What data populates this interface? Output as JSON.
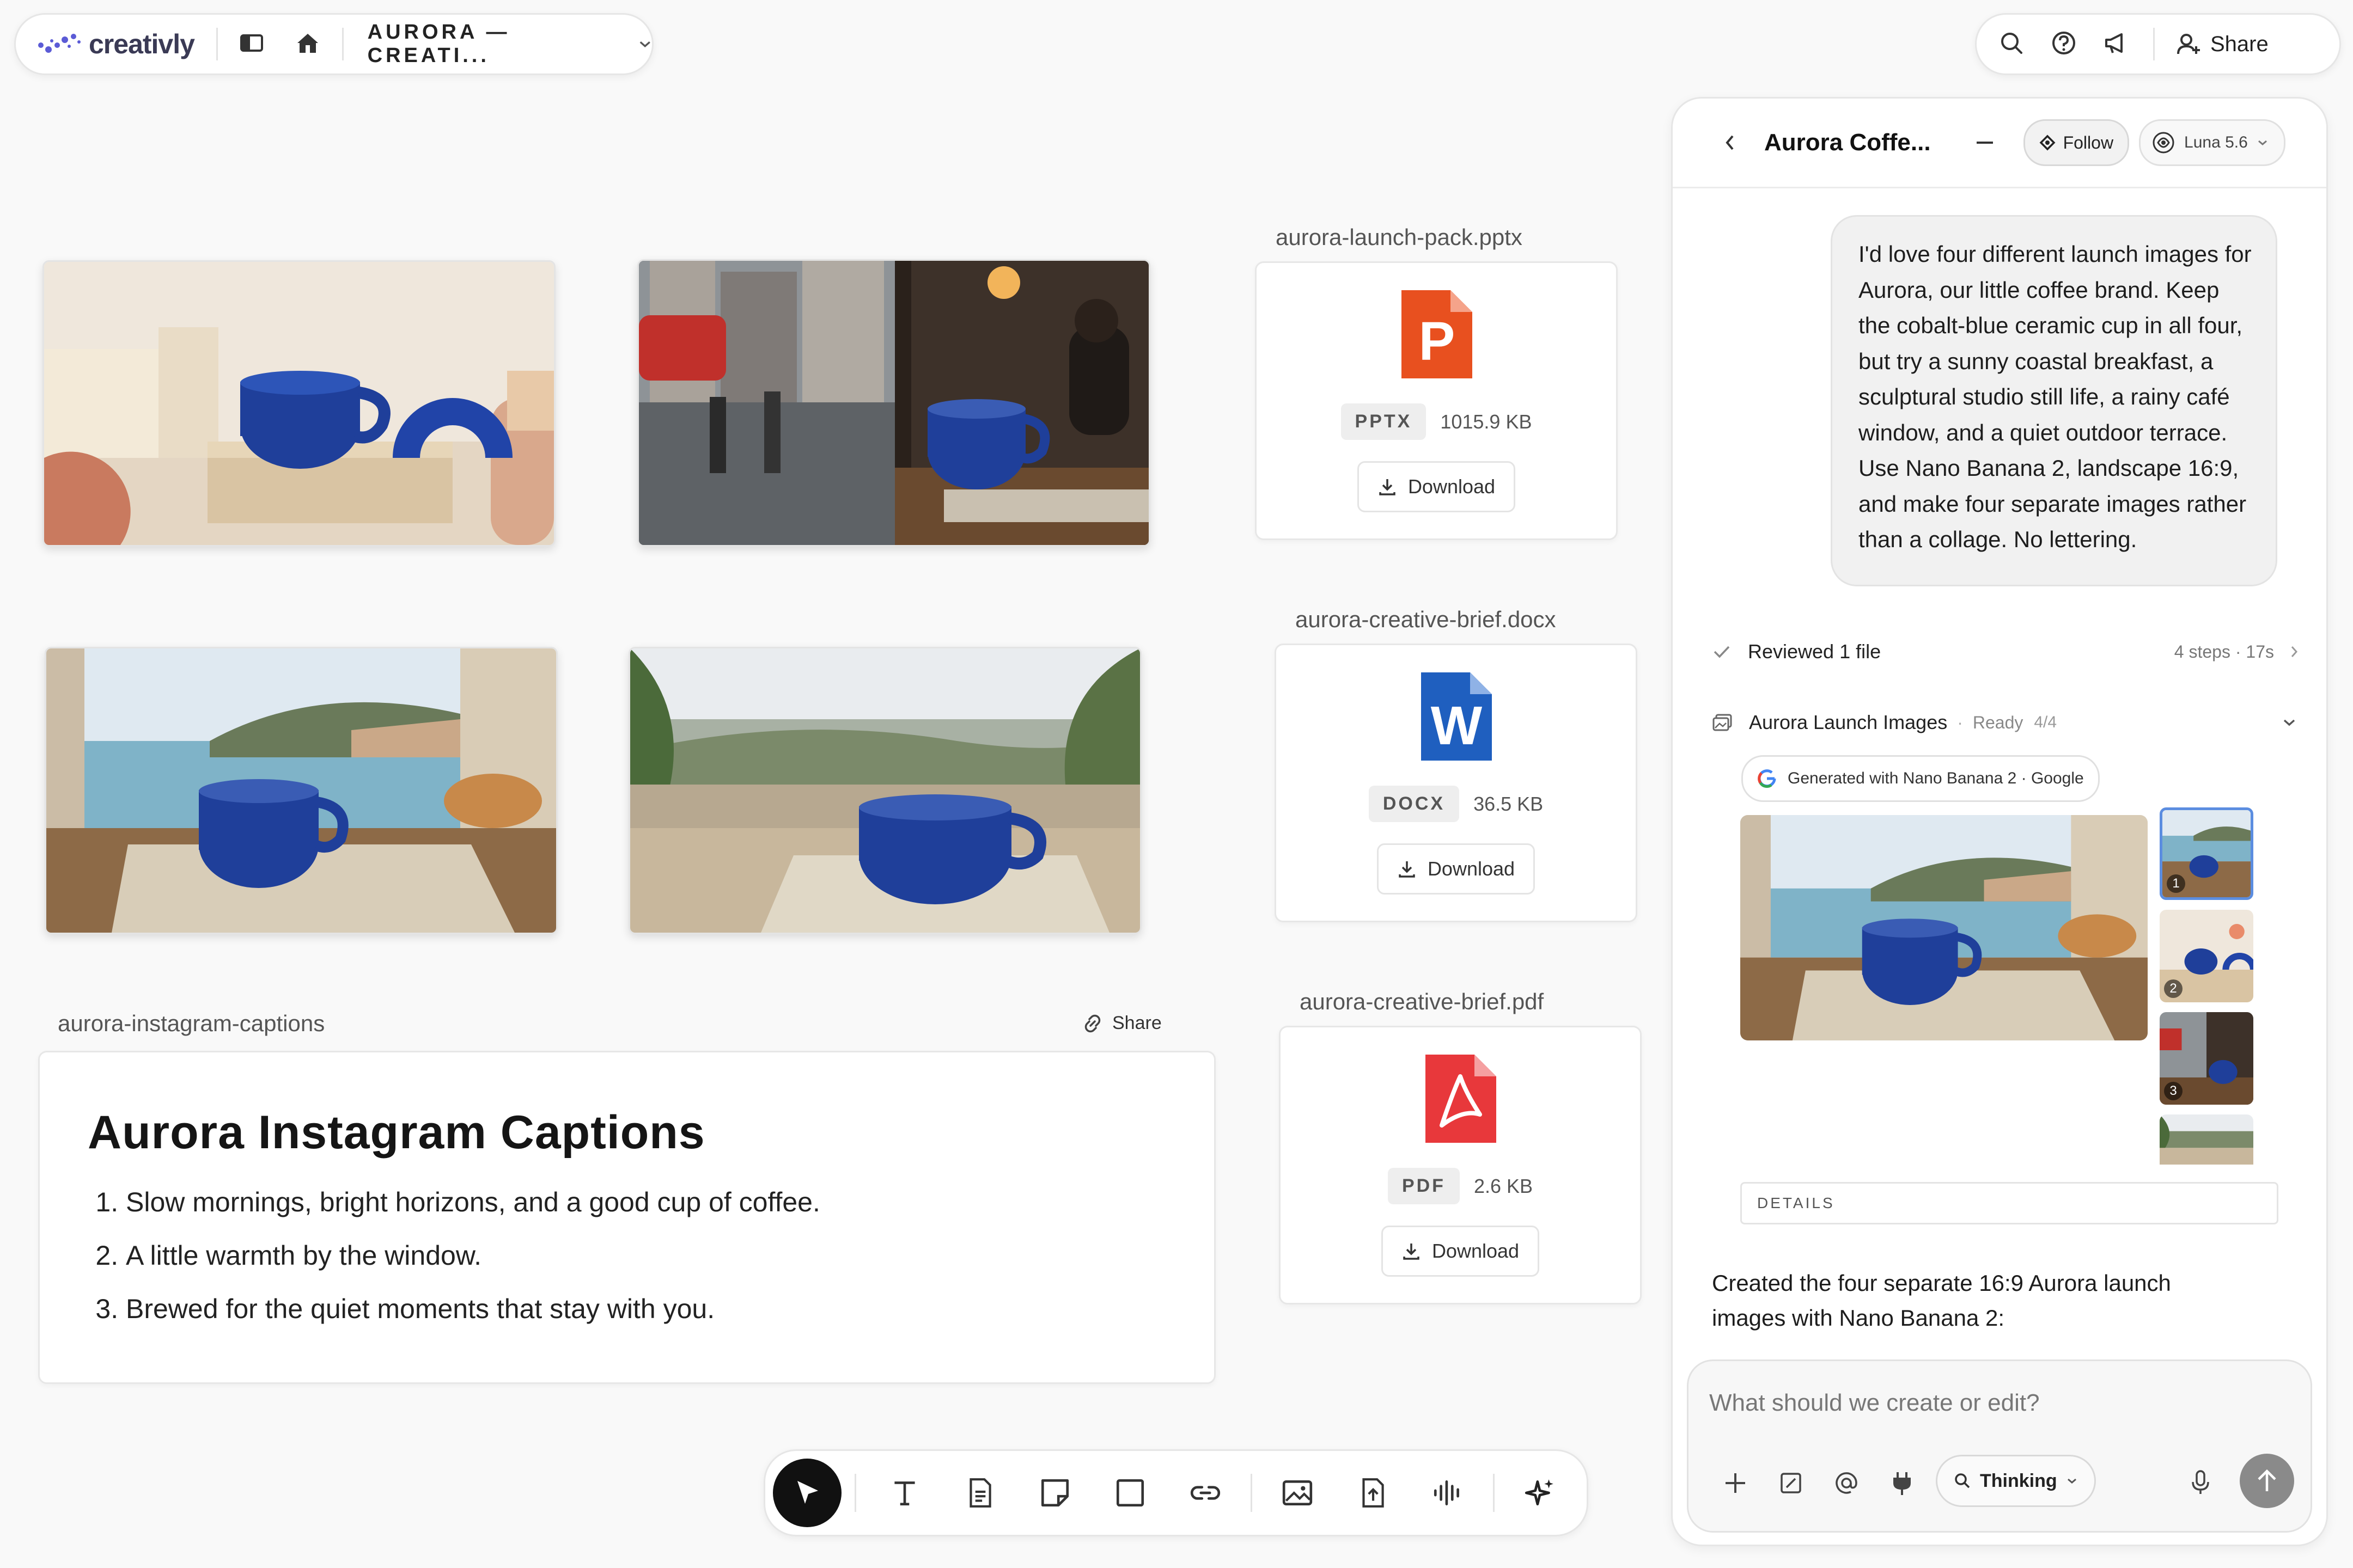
{
  "topbar": {
    "logo": "creativly",
    "project_title": "AURORA — CREATI...",
    "share_label": "Share"
  },
  "canvas": {
    "files": [
      {
        "filename": "aurora-launch-pack.pptx",
        "type": "PPTX",
        "size": "1015.9 KB",
        "download": "Download",
        "color": "#e8501f",
        "letter": "P"
      },
      {
        "filename": "aurora-creative-brief.docx",
        "type": "DOCX",
        "size": "36.5 KB",
        "download": "Download",
        "color": "#1f5fbf",
        "letter": "W"
      },
      {
        "filename": "aurora-creative-brief.pdf",
        "type": "PDF",
        "size": "2.6 KB",
        "download": "Download",
        "color": "#e8383b",
        "letter": "A"
      }
    ],
    "captions": {
      "filename": "aurora-instagram-captions",
      "share": "Share",
      "title": "Aurora Instagram Captions",
      "items": [
        "Slow mornings, bright horizons, and a good cup of coffee.",
        "A little warmth by the window.",
        "Brewed for the quiet moments that stay with you."
      ]
    }
  },
  "chat": {
    "title": "Aurora Coffe...",
    "follow": "Follow",
    "model": "Luna 5.6",
    "user_message": "I'd love four different launch images for Aurora, our little coffee brand. Keep the cobalt-blue ceramic cup in all four, but try a sunny coastal breakfast, a sculptural studio still life, a rainy café window, and a quiet outdoor terrace. Use Nano Banana 2, landscape 16:9, and make four separate images rather than a collage. No lettering.",
    "reviewed": "Reviewed 1 file",
    "steps": "4 steps · 17s",
    "gallery_title": "Aurora Launch Images",
    "gallery_status": "Ready",
    "gallery_count": "4/4",
    "generated_with": "Generated with Nano Banana 2 · Google",
    "thumb_numbers": [
      "1",
      "2",
      "3"
    ],
    "details": "DETAILS",
    "assistant_message": "Created the four separate 16:9 Aurora launch images with Nano Banana 2:",
    "input_placeholder": "What should we create or edit?",
    "thinking": "Thinking"
  },
  "colors": {
    "cup_blue": "#1f3f9a",
    "accent_dark": "#111111"
  }
}
